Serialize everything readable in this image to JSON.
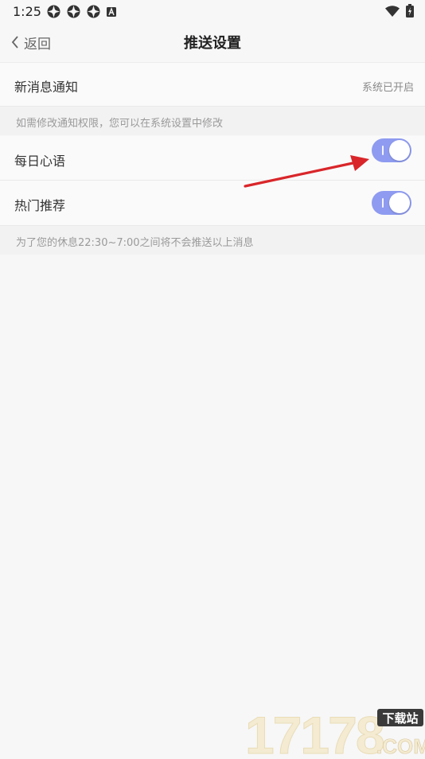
{
  "status_bar": {
    "time": "1:25",
    "left_icons": [
      "notification-icon",
      "notification-icon",
      "notification-icon",
      "a-badge-icon"
    ],
    "right_icons": [
      "wifi-icon",
      "battery-charging-icon"
    ]
  },
  "navbar": {
    "back_label": "返回",
    "title": "推送设置"
  },
  "rows": {
    "new_message": {
      "label": "新消息通知",
      "value": "系统已开启"
    },
    "hint1": "如需修改通知权限，您可以在系统设置中修改",
    "daily_quote": {
      "label": "每日心语",
      "enabled": true
    },
    "hot_recommend": {
      "label": "热门推荐",
      "enabled": true
    },
    "hint2": "为了您的休息22:30~7:00之间将不会推送以上消息"
  },
  "watermark": {
    "digits": "17178",
    "badge": "下载站",
    "suffix": ".COM"
  },
  "colors": {
    "toggle_on": "#8e9bf0",
    "background": "#f7f7f8",
    "arrow": "#d9262a"
  }
}
